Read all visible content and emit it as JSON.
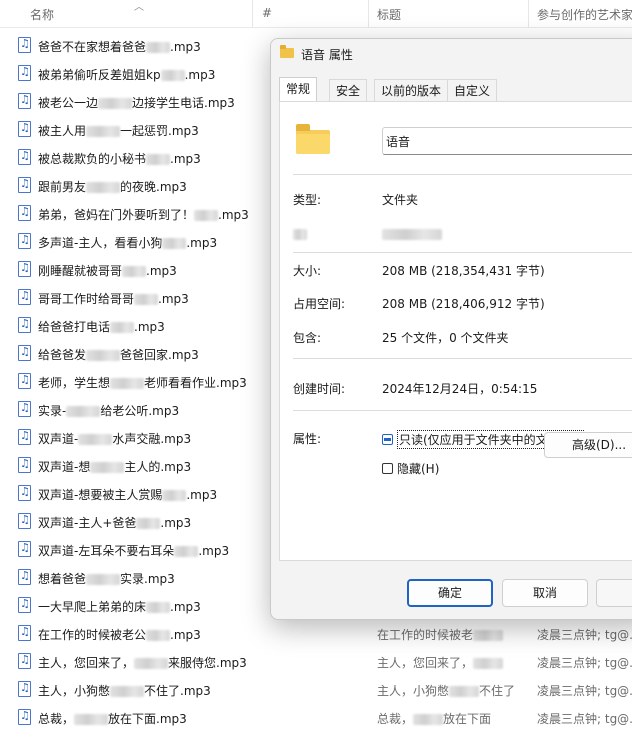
{
  "explorer": {
    "columns": {
      "name": "名称",
      "number": "#",
      "title": "标题",
      "artists": "参与创作的艺术家"
    },
    "files": [
      {
        "name": "爸爸不在家想着爸爸",
        "ext": ".mp3"
      },
      {
        "name": "被弟弟偷听反差姐姐kp",
        "ext": ".mp3"
      },
      {
        "name": "被老公一边",
        "mid": "边接学生电话",
        "ext": ".mp3"
      },
      {
        "name": "被主人用",
        "mid": "一起惩罚",
        "ext": ".mp3"
      },
      {
        "name": "被总裁欺负的小秘书",
        "ext": ".mp3"
      },
      {
        "name": "跟前男友",
        "mid": "的夜晚",
        "ext": ".mp3"
      },
      {
        "name": "弟弟，爸妈在门外要听到了！",
        "ext": ".mp3"
      },
      {
        "name": "多声道-主人，看看小狗",
        "ext": ".mp3"
      },
      {
        "name": "刚睡醒就被哥哥",
        "ext": ".mp3"
      },
      {
        "name": "哥哥工作时给哥哥",
        "ext": ".mp3"
      },
      {
        "name": "给爸爸打电话",
        "ext": ".mp3"
      },
      {
        "name": "给爸爸发",
        "mid": "爸爸回家",
        "ext": ".mp3"
      },
      {
        "name": "老师，学生想",
        "mid": "老师看看作业",
        "ext": ".mp3"
      },
      {
        "name": "实录-",
        "mid": "给老公听",
        "ext": ".mp3"
      },
      {
        "name": "双声道-",
        "mid": "水声交融",
        "ext": ".mp3"
      },
      {
        "name": "双声道-想",
        "mid": "主人的",
        "ext": ".mp3"
      },
      {
        "name": "双声道-想要被主人赏赐",
        "ext": ".mp3"
      },
      {
        "name": "双声道-主人+爸爸",
        "ext": ".mp3"
      },
      {
        "name": "双声道-左耳朵不要右耳朵",
        "ext": ".mp3"
      },
      {
        "name": "想着爸爸",
        "mid": "实录",
        "ext": ".mp3"
      },
      {
        "name": "一大早爬上弟弟的床",
        "ext": ".mp3"
      },
      {
        "name": "在工作的时候被老公",
        "ext": ".mp3",
        "title": "在工作的时候被老",
        "artist": "凌晨三点钟; tg@."
      },
      {
        "name": "主人，您回来了，",
        "mid": "来服侍您",
        "ext": ".mp3",
        "title": "主人，您回来了，",
        "artist": "凌晨三点钟; tg@."
      },
      {
        "name": "主人，小狗憋",
        "mid": "不住了",
        "ext": ".mp3",
        "title": "主人，小狗憋",
        "title2": "不住了",
        "artist": "凌晨三点钟; tg@."
      },
      {
        "name": "总裁，",
        "mid": "放在下面",
        "ext": ".mp3",
        "title": "总裁，",
        "title2": "放在下面",
        "artist": "凌晨三点钟; tg@."
      }
    ]
  },
  "dialog": {
    "title": "语音 属性",
    "tabs": [
      "常规",
      "安全",
      "以前的版本",
      "自定义"
    ],
    "folder_name": "语音",
    "type_label": "类型:",
    "type_value": "文件夹",
    "size_label": "大小:",
    "size_value": "208 MB (218,354,431 字节)",
    "disk_label": "占用空间:",
    "disk_value": "208 MB (218,406,912 字节)",
    "contains_label": "包含:",
    "contains_value": "25 个文件，0 个文件夹",
    "created_label": "创建时间:",
    "created_value": "2024年12月24日，0:54:15",
    "attributes_label": "属性:",
    "readonly_label": "只读(仅应用于文件夹中的文件)(R)",
    "hidden_label": "隐藏(H)",
    "advanced_label": "高级(D)...",
    "ok_label": "确定",
    "cancel_label": "取消",
    "apply_label": "应"
  }
}
